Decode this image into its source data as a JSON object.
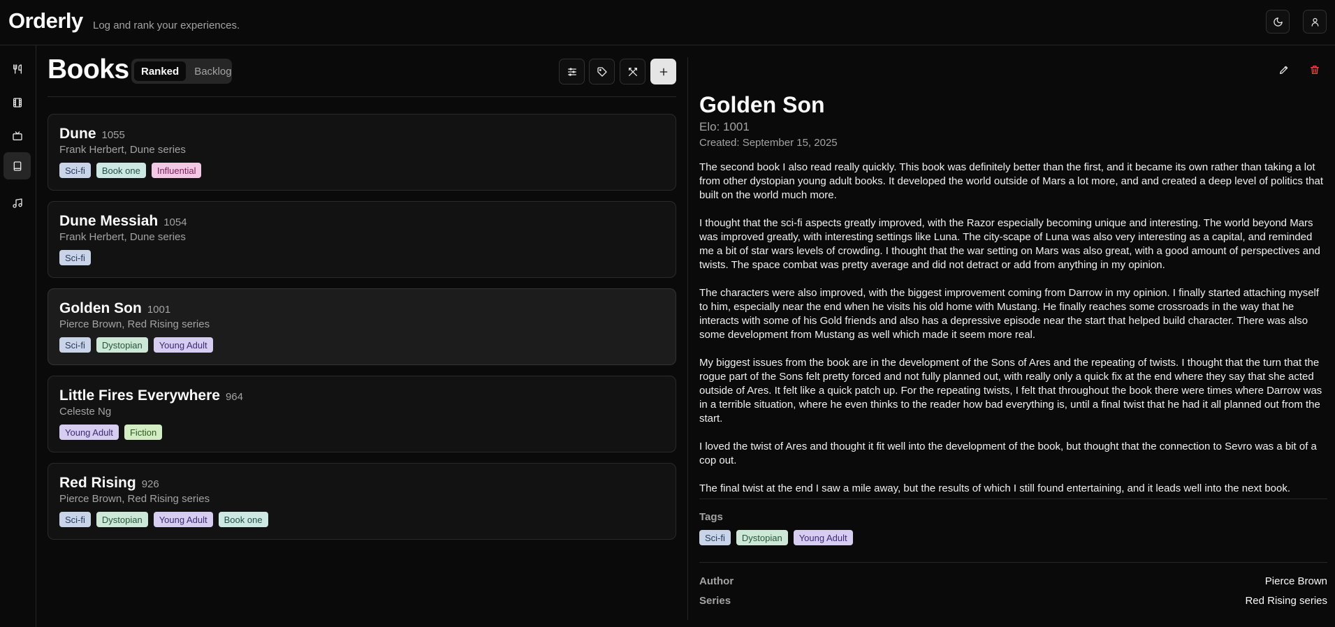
{
  "app": {
    "title": "Orderly",
    "tagline": "Log and rank your experiences."
  },
  "topbar": {
    "icons": [
      "moon-icon",
      "user-icon"
    ]
  },
  "sidebar": {
    "items": [
      {
        "icon": "utensils-icon",
        "name": "food"
      },
      {
        "icon": "film-icon",
        "name": "movies"
      },
      {
        "icon": "tv-icon",
        "name": "tv"
      },
      {
        "icon": "book-icon",
        "name": "books",
        "active": true
      },
      {
        "icon": "music-icon",
        "name": "music"
      }
    ]
  },
  "list": {
    "title": "Books",
    "tabs": [
      {
        "label": "Ranked",
        "active": true
      },
      {
        "label": "Backlog",
        "active": false
      }
    ],
    "toolbar_icons": [
      "sliders-icon",
      "tags-icon",
      "swords-icon",
      "plus-icon"
    ],
    "items": [
      {
        "name": "Dune",
        "elo": "1055",
        "subtitle": "Frank Herbert, Dune series",
        "tags": [
          {
            "label": "Sci-fi",
            "kind": "scifi"
          },
          {
            "label": "Book one",
            "kind": "bookone"
          },
          {
            "label": "Influential",
            "kind": "influential"
          }
        ]
      },
      {
        "name": "Dune Messiah",
        "elo": "1054",
        "subtitle": "Frank Herbert, Dune series",
        "tags": [
          {
            "label": "Sci-fi",
            "kind": "scifi"
          }
        ]
      },
      {
        "name": "Golden Son",
        "elo": "1001",
        "subtitle": "Pierce Brown, Red Rising series",
        "selected": true,
        "tags": [
          {
            "label": "Sci-fi",
            "kind": "scifi"
          },
          {
            "label": "Dystopian",
            "kind": "dystopian"
          },
          {
            "label": "Young Adult",
            "kind": "ya"
          }
        ]
      },
      {
        "name": "Little Fires Everywhere",
        "elo": "964",
        "subtitle": "Celeste Ng",
        "tags": [
          {
            "label": "Young Adult",
            "kind": "ya"
          },
          {
            "label": "Fiction",
            "kind": "fiction"
          }
        ]
      },
      {
        "name": "Red Rising",
        "elo": "926",
        "subtitle": "Pierce Brown, Red Rising series",
        "tags": [
          {
            "label": "Sci-fi",
            "kind": "scifi"
          },
          {
            "label": "Dystopian",
            "kind": "dystopian"
          },
          {
            "label": "Young Adult",
            "kind": "ya"
          },
          {
            "label": "Book one",
            "kind": "bookone"
          }
        ]
      }
    ]
  },
  "detail": {
    "title": "Golden Son",
    "elo": "Elo: 1001",
    "created": "Created: September 15, 2025",
    "paragraphs": [
      "The second book I also read really quickly. This book was definitely better than the first, and it became its own rather than taking a lot from other dystopian young adult books. It developed the world outside of Mars a lot more, and and created a deep level of politics that built on the world much more.",
      "I thought that the sci-fi aspects greatly improved, with the Razor especially becoming unique and interesting. The world beyond Mars was improved greatly, with interesting settings like Luna. The city-scape of Luna was also very interesting as a capital, and reminded me a bit of star wars levels of crowding. I thought that the war setting on Mars was also great, with a good amount of perspectives and twists. The space combat was pretty average and did not detract or add from anything in my opinion.",
      "The characters were also improved, with the biggest improvement coming from Darrow in my opinion. I finally started attaching myself to him, especially near the end when he visits his old home with Mustang. He finally reaches some crossroads in the way that he interacts with some of his Gold friends and also has a depressive episode near the start that helped build character. There was also some development from Mustang as well which made it seem more real.",
      "My biggest issues from the book are in the development of the Sons of Ares and the repeating of twists. I thought that the turn that the rogue part of the Sons felt pretty forced and not fully planned out, with really only a quick fix at the end where they say that she acted outside of Ares. It felt like a quick patch up. For the repeating twists, I felt that throughout the book there were times where Darrow was in a terrible situation, where he even thinks to the reader how bad everything is, until a final twist that he had it all planned out from the start.",
      "I loved the twist of Ares and thought it fit well into the development of the book, but thought that the connection to Sevro was a bit of a cop out.",
      "The final twist at the end I saw a mile away, but the results of which I still found entertaining, and it leads well into the next book."
    ],
    "tags_label": "Tags",
    "tags": [
      {
        "label": "Sci-fi",
        "kind": "scifi"
      },
      {
        "label": "Dystopian",
        "kind": "dystopian"
      },
      {
        "label": "Young Adult",
        "kind": "ya"
      }
    ],
    "author_label": "Author",
    "author_value": "Pierce Brown",
    "series_label": "Series",
    "series_value": "Red Rising series",
    "action_icons": [
      "pencil-icon",
      "trash-icon"
    ]
  },
  "colors": {
    "background": "#0a0a0a",
    "accent_delete": "#ef4444"
  }
}
